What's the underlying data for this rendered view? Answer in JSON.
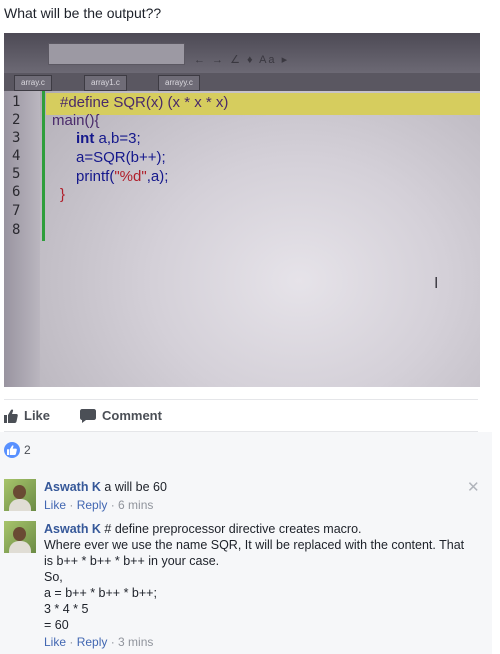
{
  "post": {
    "question": "What will be the output??"
  },
  "editor": {
    "toolbar_symbols": "← → ∠ ♦ Aa ▸",
    "tabs": [
      "array.c",
      "array1.c",
      "arrayy.c"
    ],
    "line_numbers": [
      "1",
      "2",
      "3",
      "4",
      "5",
      "6",
      "7",
      "8"
    ],
    "code": {
      "l1": "#define SQR(x) (x * x * x)",
      "l2": "main(){",
      "l3_kw": "int",
      "l3_rest": " a,b=3;",
      "l4": "a=SQR(b++);",
      "l5_fn": "printf(",
      "l5_str": "\"%d\"",
      "l5_rest": ",a);",
      "l6": "}"
    },
    "cursor": "I"
  },
  "actions": {
    "like_label": "Like",
    "comment_label": "Comment"
  },
  "reactions": {
    "count": "2"
  },
  "comments": [
    {
      "author": "Aswath K",
      "text": " a will be 60",
      "like": "Like",
      "reply": "Reply",
      "time": "6 mins"
    },
    {
      "author": "Aswath K",
      "text": " # define preprocessor directive creates macro.",
      "lines": [
        "Where ever we use the name SQR, It will be replaced with the content. That is b++ * b++ * b++ in your case.",
        "So,",
        "a = b++ * b++ * b++;",
        "3 * 4 * 5",
        "= 60"
      ],
      "like": "Like",
      "reply": "Reply",
      "time": "3 mins"
    }
  ],
  "colors": {
    "link": "#365899",
    "like_badge": "#5890ff",
    "meta": "#90949c"
  }
}
